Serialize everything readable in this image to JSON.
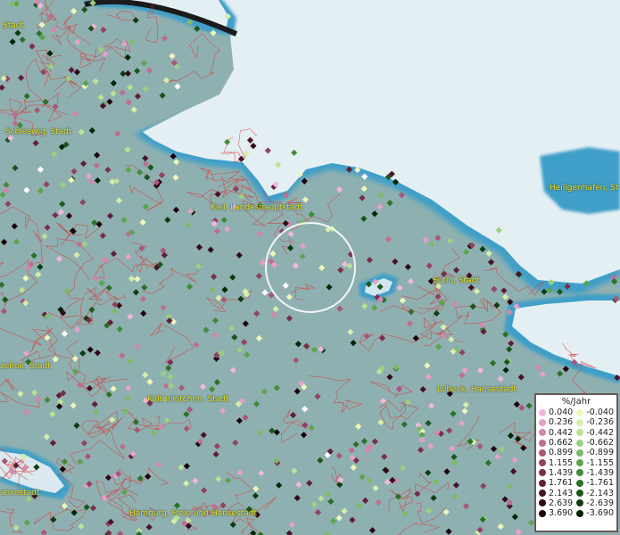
{
  "place_labels": [
    "Stadt",
    "Schleswig, Stadt",
    "Kiel, Landeshauptstadt",
    "Heiligenhafen, St",
    "Eutin, Stadt",
    "zehoe, Stadt",
    "Kaltenkirchen, Stadt",
    "Lübeck, Hansestadt",
    "ansestadt",
    "Hamburg, Freie und Hansestadt"
  ],
  "legend": {
    "title": "%/Jahr",
    "positive": [
      {
        "label": "0.040",
        "color": "#f3b6dd"
      },
      {
        "label": "0.236",
        "color": "#e7a0c8"
      },
      {
        "label": "0.442",
        "color": "#d486ad"
      },
      {
        "label": "0.662",
        "color": "#bf6d93"
      },
      {
        "label": "0.899",
        "color": "#a8577a"
      },
      {
        "label": "1.155",
        "color": "#914263"
      },
      {
        "label": "1.439",
        "color": "#7a2e4c"
      },
      {
        "label": "1.761",
        "color": "#621e38"
      },
      {
        "label": "2.143",
        "color": "#4a1226"
      },
      {
        "label": "2.639",
        "color": "#330917"
      },
      {
        "label": "3.690",
        "color": "#1c030b"
      }
    ],
    "negative": [
      {
        "label": "-0.040",
        "color": "#eef7bb"
      },
      {
        "label": "-0.236",
        "color": "#d6eeaa"
      },
      {
        "label": "-0.442",
        "color": "#bbe196"
      },
      {
        "label": "-0.662",
        "color": "#9dd07f"
      },
      {
        "label": "-0.899",
        "color": "#7dbb66"
      },
      {
        "label": "-1.155",
        "color": "#5ea34d"
      },
      {
        "label": "-1.439",
        "color": "#438b39"
      },
      {
        "label": "-1.761",
        "color": "#2c7129"
      },
      {
        "label": "-2.143",
        "color": "#1a571b"
      },
      {
        "label": "-2.639",
        "color": "#0c3d10"
      },
      {
        "label": "-3.690",
        "color": "#032407"
      }
    ]
  },
  "colors": {
    "land": "#8fb0b0",
    "sea": "#e3eef4",
    "coast": "#4aa3c8",
    "borders": "#d63a3a",
    "labels": "#f1e21f",
    "highlight_ring": "#ffffff",
    "no_data_marker": "#ffffff"
  }
}
